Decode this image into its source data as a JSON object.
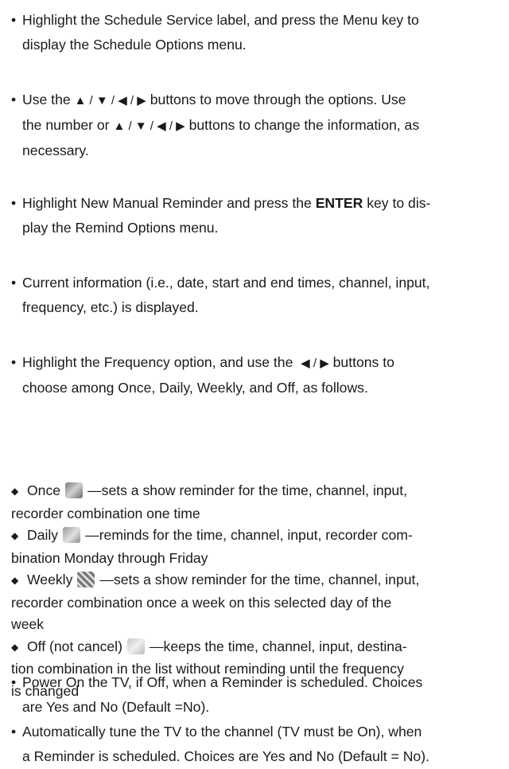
{
  "paragraphs": {
    "p1": {
      "l1": "Highlight the Schedule Service label, and press the Menu key to",
      "l2": "display the Schedule Options menu."
    },
    "p2": {
      "l1_a": "Use the",
      "l1_btns": "▲ / ▼ / ◀ / ▶",
      "l1_b": "buttons to move through the options. Use",
      "l2_a": "the number or",
      "l2_btns": "▲ / ▼ / ◀ / ▶",
      "l2_b": "buttons to change the information, as",
      "l3": "necessary."
    },
    "p3": {
      "l1_a": "Highlight New Manual Reminder and press the",
      "l1_key": "ENTER",
      "l1_b": "key to dis-",
      "l2": "play the Remind Options menu."
    },
    "p4": {
      "l1": "Current information (i.e., date, start and end times, channel, input,",
      "l2": "frequency, etc.) is displayed."
    },
    "p5": {
      "l1_a": "Highlight the Frequency option, and use the",
      "l1_btns": "◀ / ▶",
      "l1_b": "buttons to",
      "l2": "choose among Once, Daily, Weekly, and Off, as follows."
    },
    "p6": {
      "l1": "Power On the TV, if Off, when a Reminder is scheduled. Choices",
      "l2": "are Yes and No (Default =No)."
    },
    "p7": {
      "l1": "Automatically tune the TV to the channel (TV must be On), when",
      "l2": "a Reminder is scheduled. Choices are Yes and No (Default = No)."
    }
  },
  "frequency_items": [
    {
      "name": "Once",
      "icon": "once-icon",
      "l1": "—sets a show reminder for the time, channel, input,",
      "l2": "recorder combination one time"
    },
    {
      "name": "Daily",
      "icon": "daily-icon",
      "l1": "—reminds for the time, channel, input,  recorder com-",
      "l2": "bination Monday through Friday"
    },
    {
      "name": "Weekly",
      "icon": "weekly-icon",
      "l1": "—sets a show reminder for the time, channel, input,",
      "l2": "recorder combination once a week on this selected day of the",
      "l3": "week"
    },
    {
      "name": "Off (not cancel)",
      "icon": "off-icon",
      "l1": "—keeps the time, channel, input, destina-",
      "l2": "tion combination in the list without reminding until the frequency",
      "l3": "is changed"
    }
  ],
  "bullet_char": "•",
  "diamond_char": "◆"
}
